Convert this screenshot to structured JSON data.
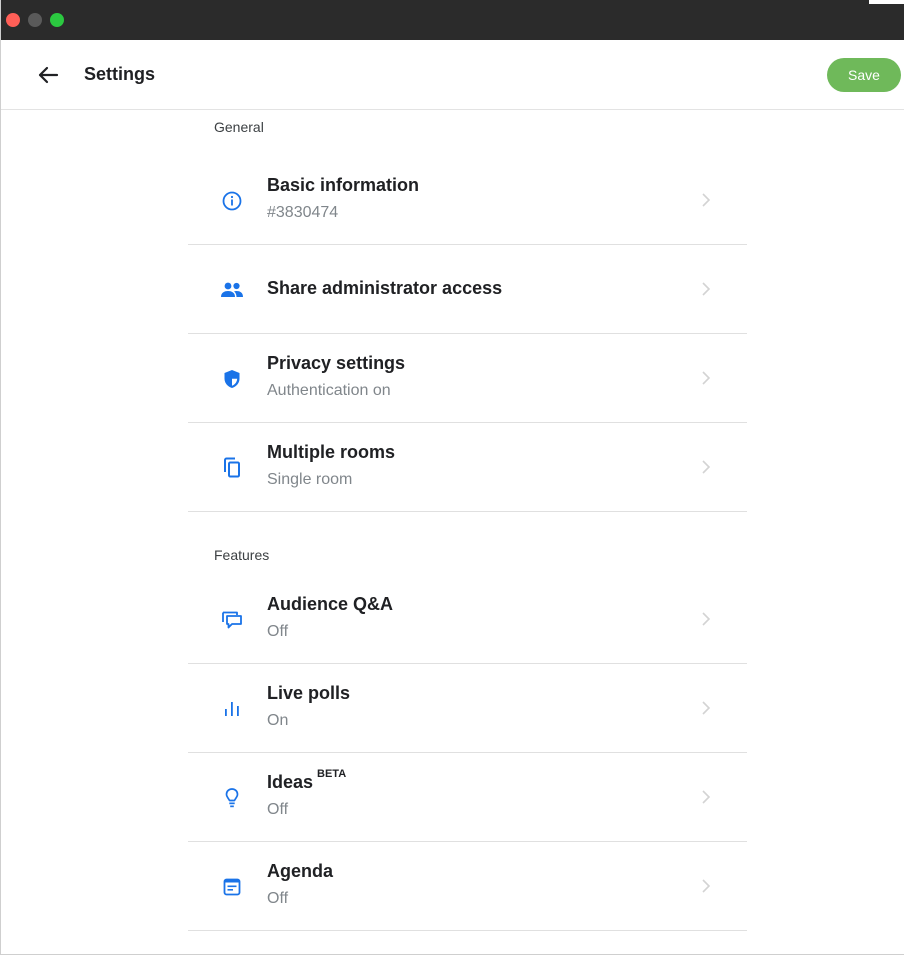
{
  "header": {
    "title": "Settings",
    "save_label": "Save"
  },
  "colors": {
    "accent_blue": "#1a73e8",
    "save_green": "#6fb95a",
    "titlebar": "#2b2b2b"
  },
  "sections": {
    "general": {
      "title": "General",
      "items": [
        {
          "title": "Basic information",
          "subtitle": "#3830474",
          "icon": "info-icon"
        },
        {
          "title": "Share administrator access",
          "icon": "people-icon"
        },
        {
          "title": "Privacy settings",
          "subtitle": "Authentication on",
          "icon": "shield-icon"
        },
        {
          "title": "Multiple rooms",
          "subtitle": "Single room",
          "icon": "copy-icon"
        }
      ]
    },
    "features": {
      "title": "Features",
      "items": [
        {
          "title": "Audience Q&A",
          "subtitle": "Off",
          "icon": "chat-bubbles-icon"
        },
        {
          "title": "Live polls",
          "subtitle": "On",
          "icon": "bar-chart-icon"
        },
        {
          "title": "Ideas",
          "badge": "BETA",
          "subtitle": "Off",
          "icon": "lightbulb-icon"
        },
        {
          "title": "Agenda",
          "subtitle": "Off",
          "icon": "agenda-icon"
        }
      ]
    }
  }
}
